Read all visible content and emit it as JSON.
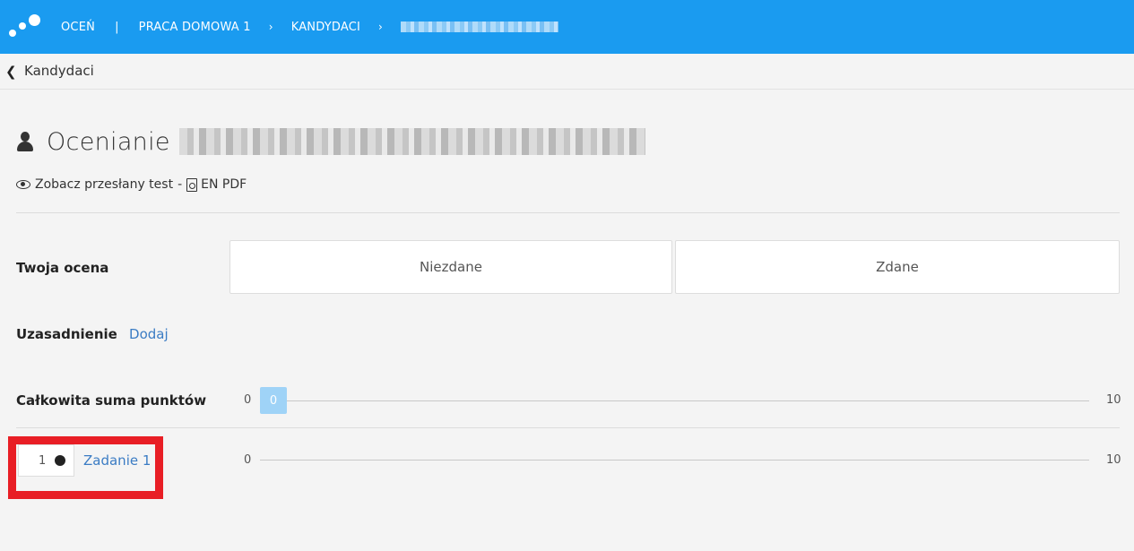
{
  "header": {
    "crumbs": [
      "OCEŃ",
      "PRACA DOMOWA 1",
      "KANDYDACI"
    ],
    "separator": "|",
    "chevron": "›"
  },
  "back": {
    "label": "Kandydaci"
  },
  "page": {
    "title": "Ocenianie"
  },
  "view": {
    "test_link": "Zobacz przesłany test",
    "dash": "-",
    "pdf_link": "EN PDF"
  },
  "grade": {
    "label": "Twoja ocena",
    "options": [
      "Niezdane",
      "Zdane"
    ]
  },
  "justification": {
    "label": "Uzasadnienie",
    "add_link": "Dodaj"
  },
  "total": {
    "label": "Całkowita suma punktów",
    "min": "0",
    "max": "10",
    "value": "0"
  },
  "task": {
    "number": "1",
    "name": "Zadanie 1",
    "min": "0",
    "max": "10"
  },
  "colors": {
    "header": "#1a9bf0",
    "link": "#3b7cc4",
    "highlight": "#e81e25",
    "handle": "#9fd3f7"
  },
  "icons": {
    "back": "chevron-left-icon",
    "user": "user-icon",
    "eye": "eye-icon",
    "pdf": "file-pdf-icon"
  }
}
